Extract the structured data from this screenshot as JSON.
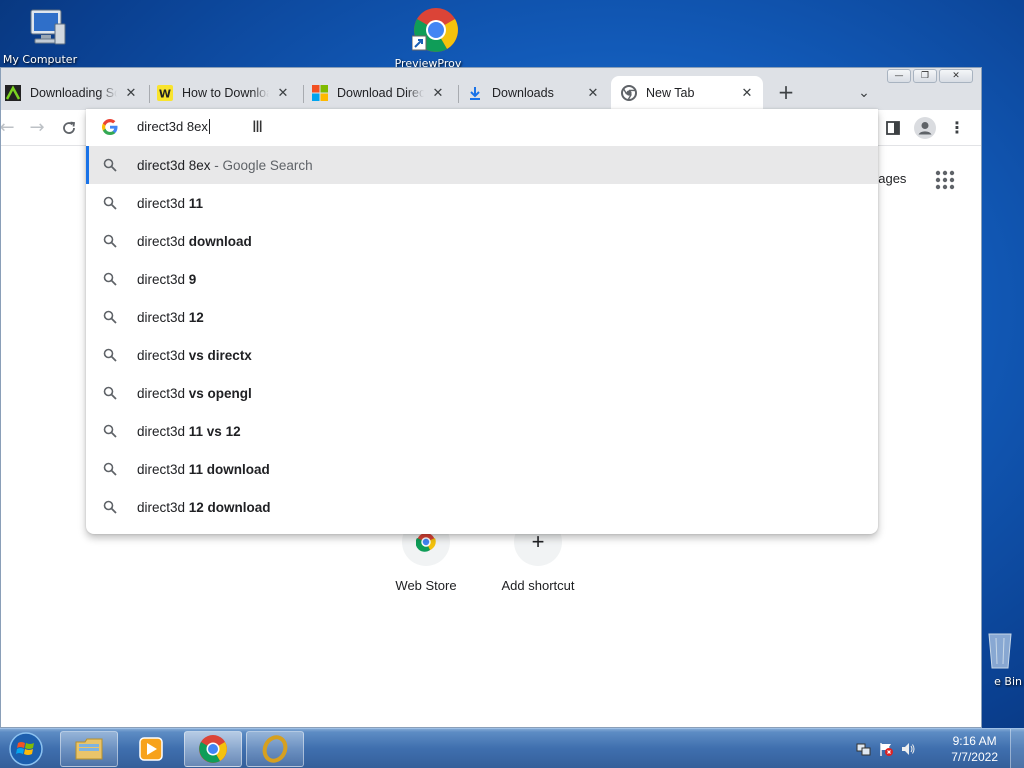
{
  "desktop": {
    "icons": [
      {
        "label": "My Computer"
      },
      {
        "label": "PreviewProv"
      },
      {
        "label": "e Bin"
      }
    ]
  },
  "browser": {
    "tabs": [
      {
        "title": "Downloading Software",
        "favicon": "wpc-icon",
        "active": false
      },
      {
        "title": "How to Download",
        "favicon": "wikihow-icon",
        "active": false
      },
      {
        "title": "Download DirectX",
        "favicon": "microsoft-icon",
        "active": false
      },
      {
        "title": "Downloads",
        "favicon": "download-icon",
        "active": false
      },
      {
        "title": "New Tab",
        "favicon": "chrome-icon",
        "active": true
      }
    ],
    "new_tab_symbol": "+",
    "omnibox": {
      "value": "direct3d 8ex",
      "suggestions": [
        {
          "prefix": "direct3d 8ex",
          "bold": "",
          "suffix": " - Google Search",
          "selected": true
        },
        {
          "prefix": "direct3d ",
          "bold": "11",
          "suffix": ""
        },
        {
          "prefix": "direct3d ",
          "bold": "download",
          "suffix": ""
        },
        {
          "prefix": "direct3d ",
          "bold": "9",
          "suffix": ""
        },
        {
          "prefix": "direct3d ",
          "bold": "12",
          "suffix": ""
        },
        {
          "prefix": "direct3d ",
          "bold": "vs directx",
          "suffix": ""
        },
        {
          "prefix": "direct3d ",
          "bold": "vs opengl",
          "suffix": ""
        },
        {
          "prefix": "direct3d ",
          "bold": "11 vs 12",
          "suffix": ""
        },
        {
          "prefix": "direct3d ",
          "bold": "11 download",
          "suffix": ""
        },
        {
          "prefix": "direct3d ",
          "bold": "12 download",
          "suffix": ""
        }
      ]
    },
    "page": {
      "images_link": "nages",
      "shortcuts": [
        {
          "label": "Web Store"
        },
        {
          "label": "Add shortcut",
          "symbol": "+"
        }
      ]
    }
  },
  "taskbar": {
    "clock_time": "9:16 AM",
    "clock_date": "7/7/2022"
  },
  "colors": {
    "accent": "#1a73e8",
    "tabstrip": "#dee1e6",
    "selected_row": "#e8e8e9"
  }
}
